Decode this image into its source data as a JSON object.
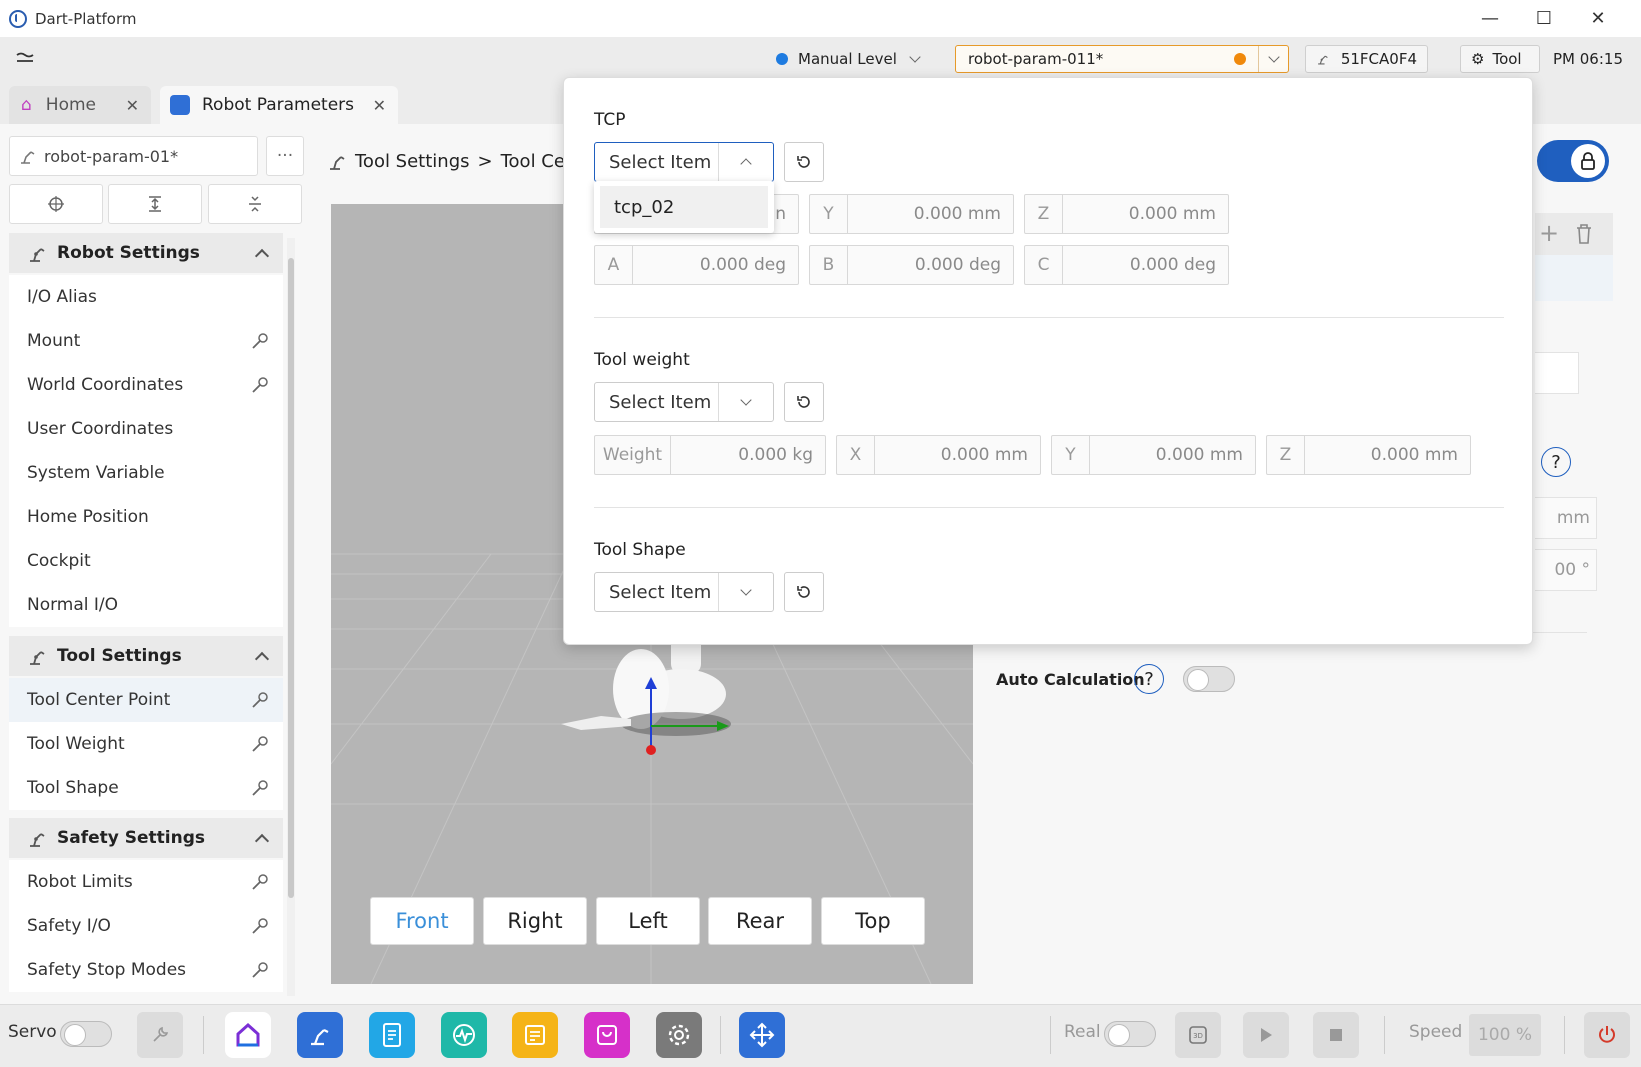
{
  "window": {
    "title": "Dart-Platform",
    "minimize": "—",
    "maximize": "☐",
    "close": "✕"
  },
  "status": {
    "manual_level": "Manual Level",
    "manual_color": "#1e7be0",
    "param_file": "robot-param-011*",
    "param_dot_color": "#f0890c",
    "device_id": "51FCA0F4",
    "tool_button": "Tool",
    "time": "PM 06:15"
  },
  "tabs": [
    {
      "label": "Home"
    },
    {
      "label": "Robot Parameters"
    }
  ],
  "sidebar": {
    "file_label": "robot-param-01*",
    "more": "···",
    "groups": [
      {
        "title": "Robot Settings",
        "items": [
          "I/O Alias",
          "Mount",
          "World Coordinates",
          "User Coordinates",
          "System Variable",
          "Home Position",
          "Cockpit",
          "Normal I/O"
        ]
      },
      {
        "title": "Tool Settings",
        "items": [
          "Tool Center Point",
          "Tool Weight",
          "Tool Shape"
        ]
      },
      {
        "title": "Safety Settings",
        "items": [
          "Robot Limits",
          "Safety I/O",
          "Safety Stop Modes"
        ]
      }
    ]
  },
  "breadcrumb": {
    "part1": "Tool Settings",
    "sep": ">",
    "part2": "Tool Cen"
  },
  "viewport": {
    "buttons": [
      "Front",
      "Right",
      "Left",
      "Rear",
      "Top"
    ],
    "active_color": "#3a8fd9"
  },
  "right_panel": {
    "auto_calc": "Auto Calculation",
    "help": "?",
    "unit_mm": "mm",
    "unit_deg": "00 °"
  },
  "popup": {
    "tcp": {
      "title": "TCP",
      "select": "Select Item",
      "option": "tcp_02",
      "partial_unit": "n",
      "fields": [
        {
          "label": "Y",
          "value": "0.000 mm"
        },
        {
          "label": "Z",
          "value": "0.000 mm"
        },
        {
          "label": "A",
          "value": "0.000 deg"
        },
        {
          "label": "B",
          "value": "0.000 deg"
        },
        {
          "label": "C",
          "value": "0.000 deg"
        }
      ]
    },
    "weight": {
      "title": "Tool weight",
      "select": "Select Item",
      "fields": [
        {
          "label": "Weight",
          "value": "0.000 kg"
        },
        {
          "label": "X",
          "value": "0.000 mm"
        },
        {
          "label": "Y",
          "value": "0.000 mm"
        },
        {
          "label": "Z",
          "value": "0.000 mm"
        }
      ]
    },
    "shape": {
      "title": "Tool Shape",
      "select": "Select Item"
    }
  },
  "bottom": {
    "servo": "Servo",
    "real": "Real",
    "speed_label": "Speed",
    "speed_value": "100 %",
    "app_colors": [
      "#ffffff",
      "#2f6fd6",
      "#22a7e6",
      "#1fb8a8",
      "#f5b417",
      "#d630c9",
      "#7a7a7a",
      "#2f6fd6"
    ]
  }
}
